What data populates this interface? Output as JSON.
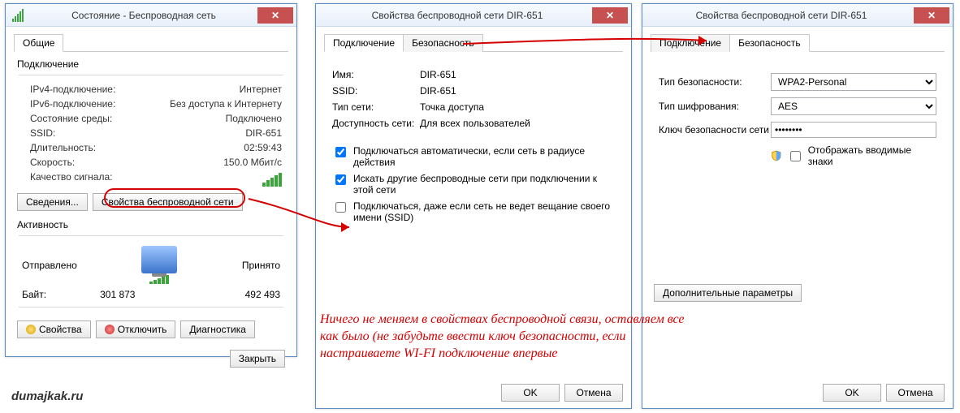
{
  "window1": {
    "title": "Состояние - Беспроводная сеть",
    "tab_general": "Общие",
    "group_connection": "Подключение",
    "ipv4_label": "IPv4-подключение:",
    "ipv4_value": "Интернет",
    "ipv6_label": "IPv6-подключение:",
    "ipv6_value": "Без доступа к Интернету",
    "media_label": "Состояние среды:",
    "media_value": "Подключено",
    "ssid_label": "SSID:",
    "ssid_value": "DIR-651",
    "duration_label": "Длительность:",
    "duration_value": "02:59:43",
    "speed_label": "Скорость:",
    "speed_value": "150.0 Мбит/с",
    "quality_label": "Качество сигнала:",
    "details_btn": "Сведения...",
    "wifi_props_btn": "Свойства беспроводной сети",
    "group_activity": "Активность",
    "sent_label": "Отправлено",
    "recv_label": "Принято",
    "bytes_label": "Байт:",
    "bytes_sent": "301 873",
    "bytes_recv": "492 493",
    "props_btn": "Свойства",
    "disable_btn": "Отключить",
    "diag_btn": "Диагностика",
    "close_btn": "Закрыть"
  },
  "window2": {
    "title": "Свойства беспроводной сети DIR-651",
    "tab_connection": "Подключение",
    "tab_security": "Безопасность",
    "name_label": "Имя:",
    "name_value": "DIR-651",
    "ssid_label": "SSID:",
    "ssid_value": "DIR-651",
    "nettype_label": "Тип сети:",
    "nettype_value": "Точка доступа",
    "avail_label": "Доступность сети:",
    "avail_value": "Для всех пользователей",
    "chk1": "Подключаться автоматически, если сеть в радиусе действия",
    "chk2": "Искать другие беспроводные сети при подключении к этой сети",
    "chk3": "Подключаться, даже если сеть не ведет вещание своего имени (SSID)",
    "ok_btn": "OK",
    "cancel_btn": "Отмена"
  },
  "window3": {
    "title": "Свойства беспроводной сети DIR-651",
    "tab_connection": "Подключение",
    "tab_security": "Безопасность",
    "sectype_label": "Тип безопасности:",
    "sectype_value": "WPA2-Personal",
    "enc_label": "Тип шифрования:",
    "enc_value": "AES",
    "key_label": "Ключ безопасности сети",
    "key_value": "••••••••",
    "show_chars": "Отображать вводимые знаки",
    "adv_btn": "Дополнительные параметры",
    "ok_btn": "OK",
    "cancel_btn": "Отмена"
  },
  "annotation": "Ничего не меняем в свойствах беспроводной связи, оставляем все как было (не забудьте ввести ключ безопасности, если настраиваете WI-FI подключение впервые",
  "watermark": "dumajkak.ru"
}
